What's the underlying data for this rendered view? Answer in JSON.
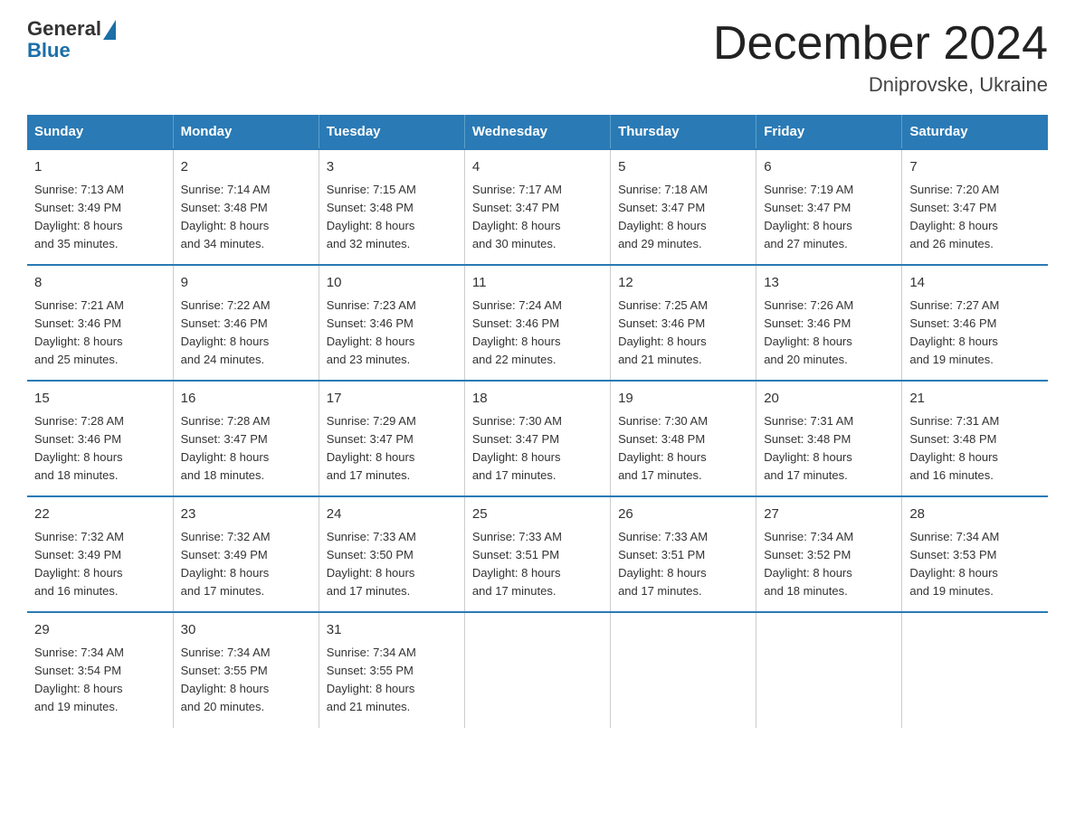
{
  "logo": {
    "general": "General",
    "blue": "Blue"
  },
  "header": {
    "month_year": "December 2024",
    "location": "Dniprovske, Ukraine"
  },
  "weekdays": [
    "Sunday",
    "Monday",
    "Tuesday",
    "Wednesday",
    "Thursday",
    "Friday",
    "Saturday"
  ],
  "weeks": [
    [
      {
        "day": "1",
        "sunrise": "7:13 AM",
        "sunset": "3:49 PM",
        "daylight": "8 hours and 35 minutes."
      },
      {
        "day": "2",
        "sunrise": "7:14 AM",
        "sunset": "3:48 PM",
        "daylight": "8 hours and 34 minutes."
      },
      {
        "day": "3",
        "sunrise": "7:15 AM",
        "sunset": "3:48 PM",
        "daylight": "8 hours and 32 minutes."
      },
      {
        "day": "4",
        "sunrise": "7:17 AM",
        "sunset": "3:47 PM",
        "daylight": "8 hours and 30 minutes."
      },
      {
        "day": "5",
        "sunrise": "7:18 AM",
        "sunset": "3:47 PM",
        "daylight": "8 hours and 29 minutes."
      },
      {
        "day": "6",
        "sunrise": "7:19 AM",
        "sunset": "3:47 PM",
        "daylight": "8 hours and 27 minutes."
      },
      {
        "day": "7",
        "sunrise": "7:20 AM",
        "sunset": "3:47 PM",
        "daylight": "8 hours and 26 minutes."
      }
    ],
    [
      {
        "day": "8",
        "sunrise": "7:21 AM",
        "sunset": "3:46 PM",
        "daylight": "8 hours and 25 minutes."
      },
      {
        "day": "9",
        "sunrise": "7:22 AM",
        "sunset": "3:46 PM",
        "daylight": "8 hours and 24 minutes."
      },
      {
        "day": "10",
        "sunrise": "7:23 AM",
        "sunset": "3:46 PM",
        "daylight": "8 hours and 23 minutes."
      },
      {
        "day": "11",
        "sunrise": "7:24 AM",
        "sunset": "3:46 PM",
        "daylight": "8 hours and 22 minutes."
      },
      {
        "day": "12",
        "sunrise": "7:25 AM",
        "sunset": "3:46 PM",
        "daylight": "8 hours and 21 minutes."
      },
      {
        "day": "13",
        "sunrise": "7:26 AM",
        "sunset": "3:46 PM",
        "daylight": "8 hours and 20 minutes."
      },
      {
        "day": "14",
        "sunrise": "7:27 AM",
        "sunset": "3:46 PM",
        "daylight": "8 hours and 19 minutes."
      }
    ],
    [
      {
        "day": "15",
        "sunrise": "7:28 AM",
        "sunset": "3:46 PM",
        "daylight": "8 hours and 18 minutes."
      },
      {
        "day": "16",
        "sunrise": "7:28 AM",
        "sunset": "3:47 PM",
        "daylight": "8 hours and 18 minutes."
      },
      {
        "day": "17",
        "sunrise": "7:29 AM",
        "sunset": "3:47 PM",
        "daylight": "8 hours and 17 minutes."
      },
      {
        "day": "18",
        "sunrise": "7:30 AM",
        "sunset": "3:47 PM",
        "daylight": "8 hours and 17 minutes."
      },
      {
        "day": "19",
        "sunrise": "7:30 AM",
        "sunset": "3:48 PM",
        "daylight": "8 hours and 17 minutes."
      },
      {
        "day": "20",
        "sunrise": "7:31 AM",
        "sunset": "3:48 PM",
        "daylight": "8 hours and 17 minutes."
      },
      {
        "day": "21",
        "sunrise": "7:31 AM",
        "sunset": "3:48 PM",
        "daylight": "8 hours and 16 minutes."
      }
    ],
    [
      {
        "day": "22",
        "sunrise": "7:32 AM",
        "sunset": "3:49 PM",
        "daylight": "8 hours and 16 minutes."
      },
      {
        "day": "23",
        "sunrise": "7:32 AM",
        "sunset": "3:49 PM",
        "daylight": "8 hours and 17 minutes."
      },
      {
        "day": "24",
        "sunrise": "7:33 AM",
        "sunset": "3:50 PM",
        "daylight": "8 hours and 17 minutes."
      },
      {
        "day": "25",
        "sunrise": "7:33 AM",
        "sunset": "3:51 PM",
        "daylight": "8 hours and 17 minutes."
      },
      {
        "day": "26",
        "sunrise": "7:33 AM",
        "sunset": "3:51 PM",
        "daylight": "8 hours and 17 minutes."
      },
      {
        "day": "27",
        "sunrise": "7:34 AM",
        "sunset": "3:52 PM",
        "daylight": "8 hours and 18 minutes."
      },
      {
        "day": "28",
        "sunrise": "7:34 AM",
        "sunset": "3:53 PM",
        "daylight": "8 hours and 19 minutes."
      }
    ],
    [
      {
        "day": "29",
        "sunrise": "7:34 AM",
        "sunset": "3:54 PM",
        "daylight": "8 hours and 19 minutes."
      },
      {
        "day": "30",
        "sunrise": "7:34 AM",
        "sunset": "3:55 PM",
        "daylight": "8 hours and 20 minutes."
      },
      {
        "day": "31",
        "sunrise": "7:34 AM",
        "sunset": "3:55 PM",
        "daylight": "8 hours and 21 minutes."
      },
      null,
      null,
      null,
      null
    ]
  ],
  "labels": {
    "sunrise": "Sunrise:",
    "sunset": "Sunset:",
    "daylight": "Daylight:"
  }
}
